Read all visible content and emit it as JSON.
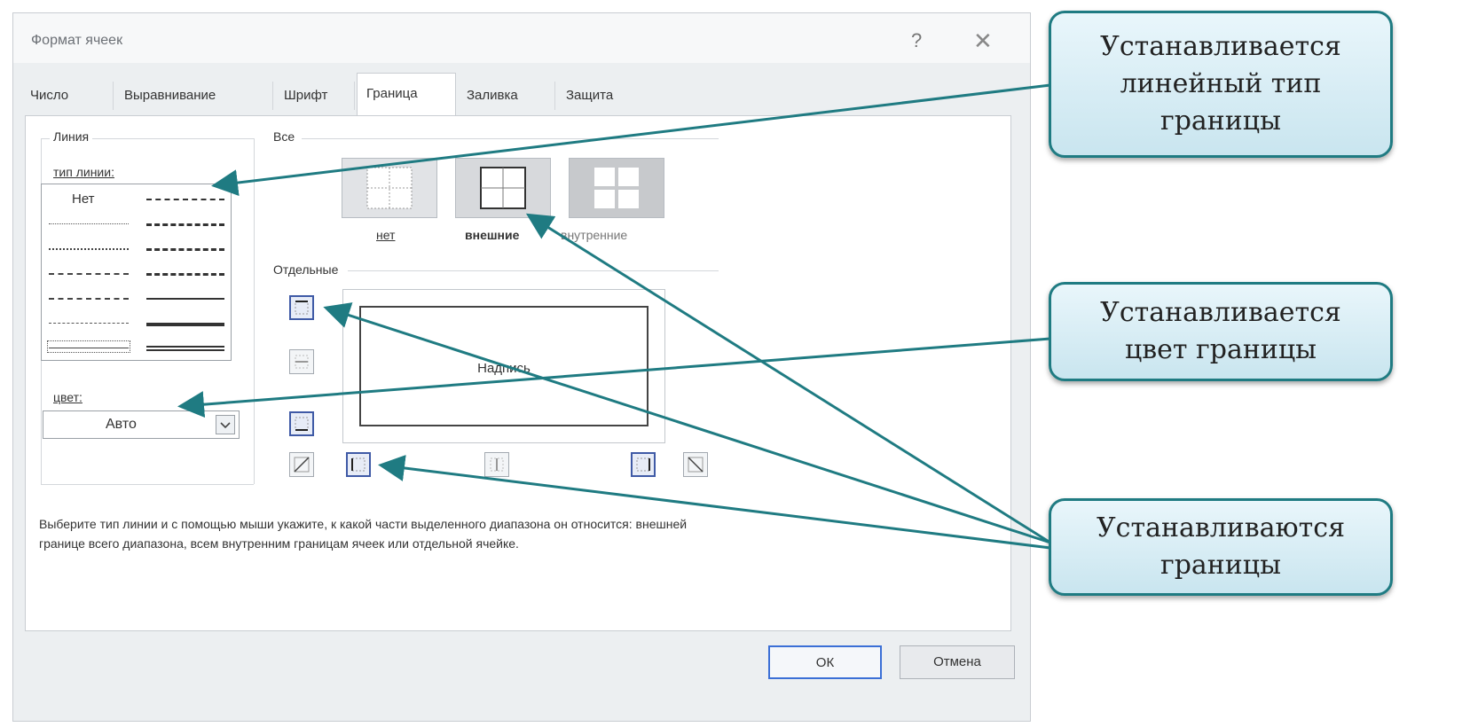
{
  "dialog": {
    "title": "Формат ячеек",
    "help_glyph": "?",
    "close_glyph": "✕"
  },
  "tabs": [
    {
      "label": "Число"
    },
    {
      "label": "Выравнивание"
    },
    {
      "label": "Шрифт"
    },
    {
      "label": "Граница",
      "active": true
    },
    {
      "label": "Заливка"
    },
    {
      "label": "Защита"
    }
  ],
  "line_group": {
    "title": "Линия",
    "type_label": "тип линии:",
    "none_label": "Нет",
    "color_label": "цвет:",
    "color_value": "Авто"
  },
  "all_group": {
    "title": "Все",
    "presets": [
      {
        "label": "нет",
        "icon": "border-none-icon"
      },
      {
        "label": "внешние",
        "icon": "border-outside-icon"
      },
      {
        "label": "внутренние",
        "icon": "border-inside-icon"
      }
    ]
  },
  "separate_group": {
    "title": "Отдельные",
    "preview_text": "Надпись",
    "buttons": [
      "border-top-icon",
      "border-horizontal-inside-icon",
      "border-bottom-icon",
      "border-diagonal-up-icon",
      "border-left-icon",
      "border-vertical-inside-icon",
      "border-right-icon",
      "border-diagonal-down-icon"
    ]
  },
  "hint": {
    "line1": "Выберите тип линии и с помощью мыши укажите, к какой части выделенного диапазона он относится: внешней",
    "line2": "границе всего диапазона, всем внутренним границам ячеек или отдельной ячейке."
  },
  "buttons": {
    "ok": "ОК",
    "cancel": "Отмена"
  },
  "callouts": {
    "line_type": [
      "Устанавливается",
      "линейный тип",
      "границы"
    ],
    "color": [
      "Устанавливается",
      "цвет границы"
    ],
    "borders": [
      "Устанавливаются",
      "границы"
    ]
  },
  "colors": {
    "accent": "#1f7b82",
    "callout_bg": "#d8eef5",
    "selected_border": "#3f5aa6"
  }
}
